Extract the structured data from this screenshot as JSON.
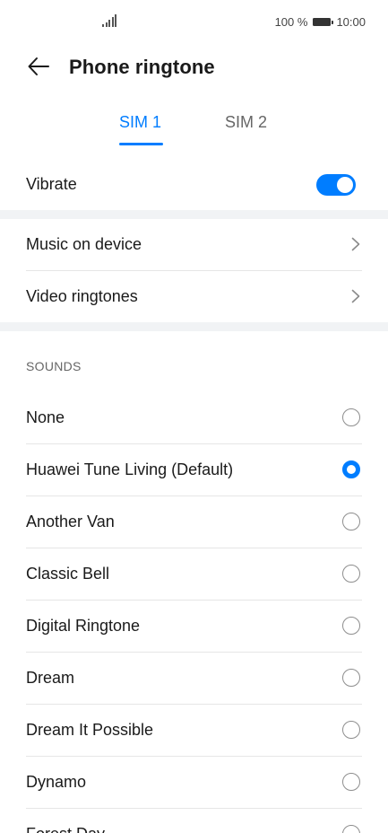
{
  "status_bar": {
    "battery_percent": "100 %",
    "time": "10:00"
  },
  "header": {
    "title": "Phone ringtone"
  },
  "tabs": [
    {
      "label": "SIM 1",
      "active": true
    },
    {
      "label": "SIM 2",
      "active": false
    }
  ],
  "vibrate": {
    "label": "Vibrate",
    "enabled": true
  },
  "nav_items": [
    {
      "label": "Music on device"
    },
    {
      "label": "Video ringtones"
    }
  ],
  "sounds": {
    "header": "SOUNDS",
    "items": [
      {
        "label": "None",
        "selected": false
      },
      {
        "label": "Huawei Tune Living (Default)",
        "selected": true
      },
      {
        "label": "Another Van",
        "selected": false
      },
      {
        "label": "Classic Bell",
        "selected": false
      },
      {
        "label": "Digital Ringtone",
        "selected": false
      },
      {
        "label": "Dream",
        "selected": false
      },
      {
        "label": "Dream It Possible",
        "selected": false
      },
      {
        "label": "Dynamo",
        "selected": false
      },
      {
        "label": "Forest Day",
        "selected": false
      }
    ]
  },
  "colors": {
    "accent": "#007dff",
    "text": "#1a1a1a",
    "secondary_text": "#666666",
    "section_gap": "#f1f3f5"
  }
}
